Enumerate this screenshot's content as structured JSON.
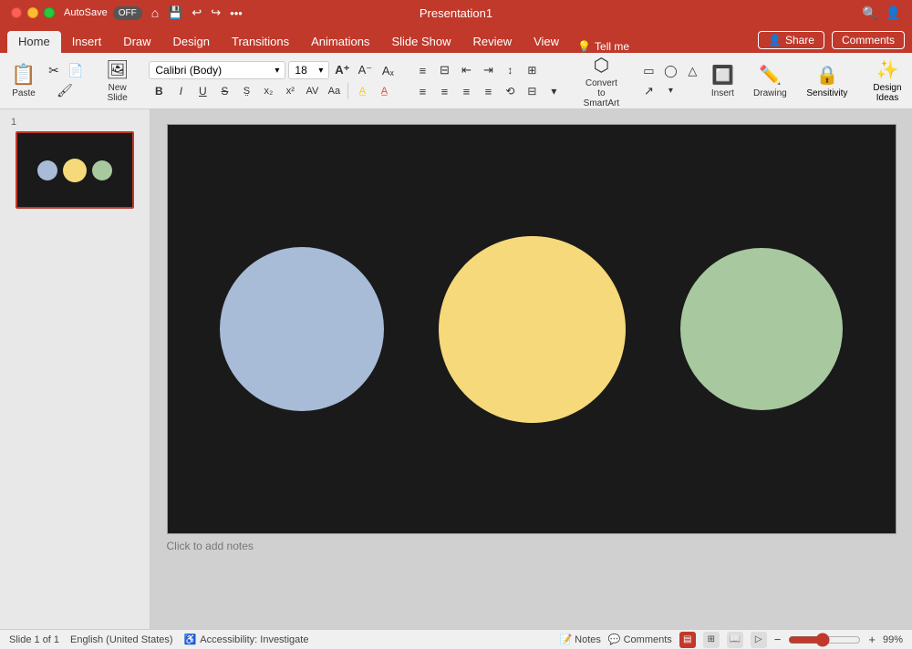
{
  "title_bar": {
    "traffic_lights": [
      "red",
      "yellow",
      "green"
    ],
    "autosave_label": "AutoSave",
    "autosave_state": "OFF",
    "title": "Presentation1",
    "icons": [
      "home",
      "save",
      "undo",
      "redo",
      "more"
    ],
    "search_icon": "🔍",
    "share_icon": "👤"
  },
  "ribbon": {
    "tabs": [
      "Home",
      "Insert",
      "Draw",
      "Design",
      "Transitions",
      "Animations",
      "Slide Show",
      "Review",
      "View"
    ],
    "active_tab": "Home",
    "tell_me": "Tell me",
    "share_label": "Share",
    "comments_label": "Comments"
  },
  "toolbar": {
    "paste_label": "Paste",
    "new_slide_label": "New\nSlide",
    "font_name": "Calibri (Body)",
    "font_size": "18",
    "bold": "B",
    "italic": "I",
    "underline": "U",
    "strikethrough": "S",
    "subscript": "x₂",
    "superscript": "x²",
    "format_painter": "A",
    "font_color": "A",
    "convert_to_smartart_label": "Convert to\nSmartArt",
    "insert_label": "Insert",
    "drawing_label": "Drawing",
    "sensitivity_label": "Sensitivity",
    "design_ideas_label": "Design\nIdeas"
  },
  "slide_panel": {
    "slide_number": "1",
    "circles": [
      {
        "color": "#a8bcd8"
      },
      {
        "color": "#f5d97a"
      },
      {
        "color": "#a8c8a0"
      }
    ]
  },
  "slide": {
    "background": "#1a1a1a",
    "circles": [
      {
        "color": "#a8bcd8",
        "size": 180
      },
      {
        "color": "#f5d97a",
        "size": 205
      },
      {
        "color": "#a8c8a0",
        "size": 178
      }
    ],
    "notes_placeholder": "Click to add notes"
  },
  "status_bar": {
    "slide_info": "Slide 1 of 1",
    "language": "English (United States)",
    "accessibility_label": "Accessibility: Investigate",
    "notes_label": "Notes",
    "comments_label": "Comments",
    "zoom_level": "99%",
    "zoom_value": 99
  }
}
